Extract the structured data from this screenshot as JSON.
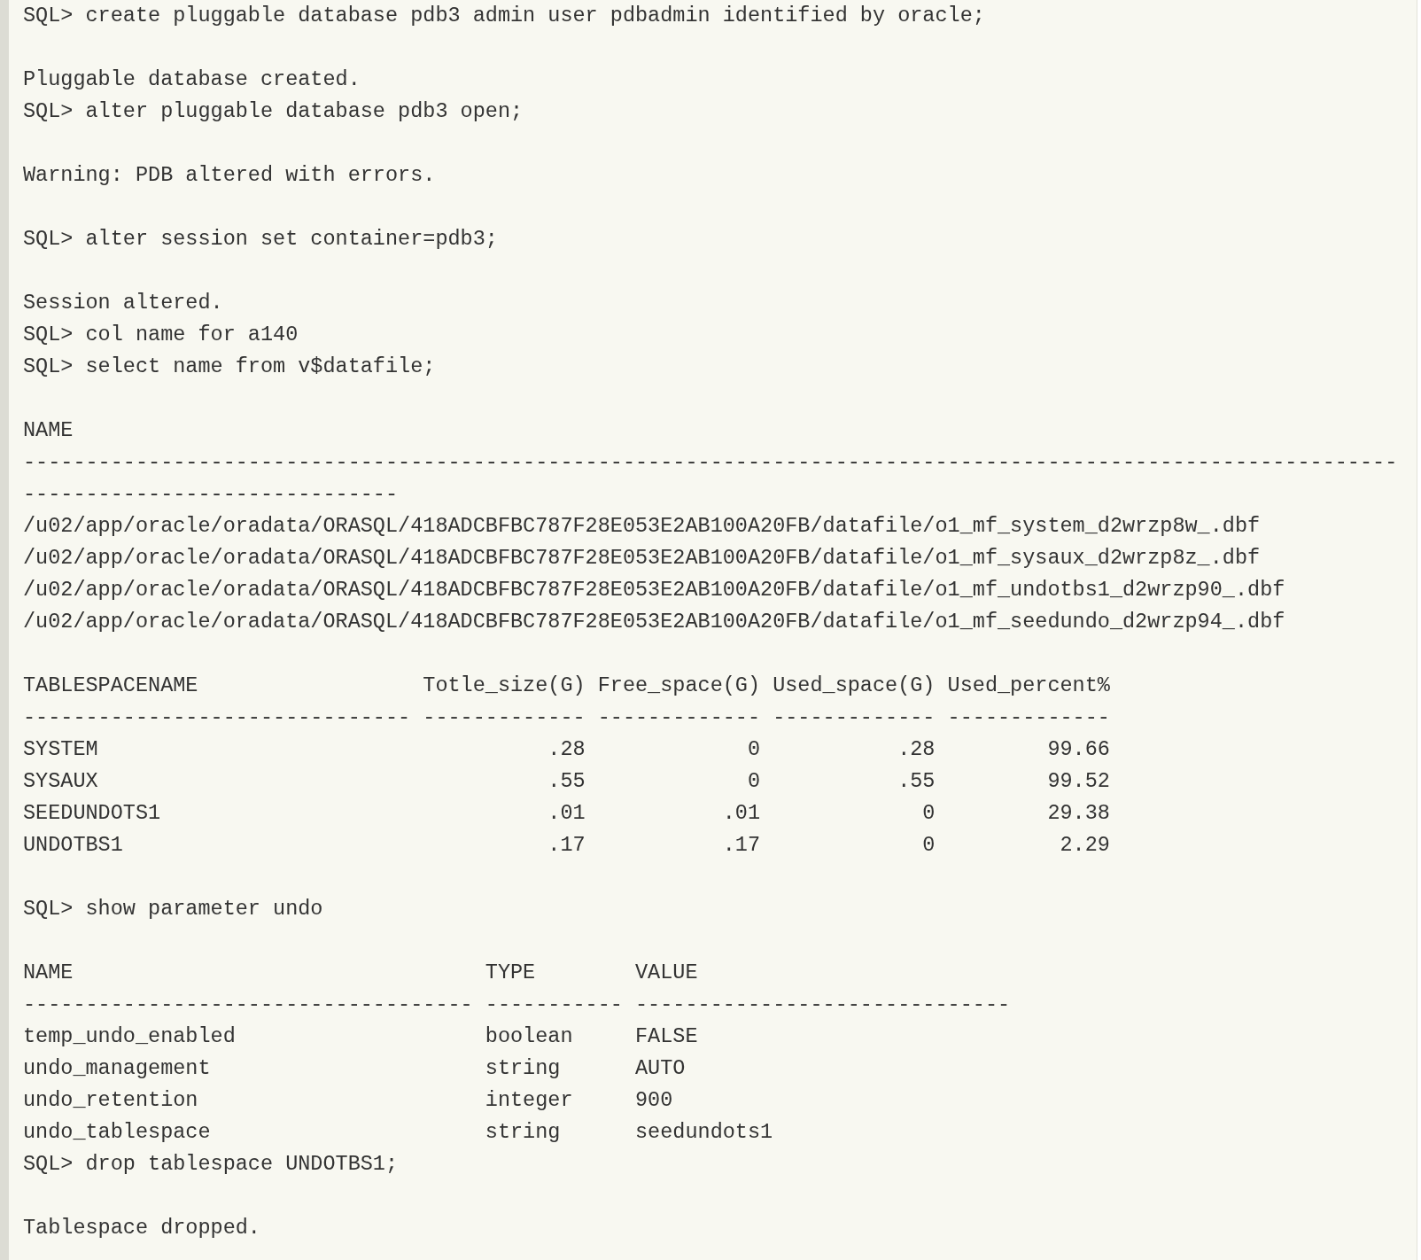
{
  "transcript": [
    [
      "SQL> create pluggable database pdb3 admin user pdbadmin identified by oracle;"
    ],
    [
      "Pluggable database created.",
      "SQL> alter pluggable database pdb3 open;"
    ],
    [
      "Warning: PDB altered with errors."
    ],
    [
      "SQL> alter session set container=pdb3;"
    ],
    [
      "Session altered.",
      "SQL> col name for a140",
      "SQL> select name from v$datafile;"
    ],
    [
      "NAME",
      "--------------------------------------------------------------------------------------------------------------------------------------------",
      "/u02/app/oracle/oradata/ORASQL/418ADCBFBC787F28E053E2AB100A20FB/datafile/o1_mf_system_d2wrzp8w_.dbf",
      "/u02/app/oracle/oradata/ORASQL/418ADCBFBC787F28E053E2AB100A20FB/datafile/o1_mf_sysaux_d2wrzp8z_.dbf",
      "/u02/app/oracle/oradata/ORASQL/418ADCBFBC787F28E053E2AB100A20FB/datafile/o1_mf_undotbs1_d2wrzp90_.dbf",
      "/u02/app/oracle/oradata/ORASQL/418ADCBFBC787F28E053E2AB100A20FB/datafile/o1_mf_seedundo_d2wrzp94_.dbf"
    ],
    [
      "TABLESPACENAME                  Totle_size(G) Free_space(G) Used_space(G) Used_percent%",
      "------------------------------- ------------- ------------- ------------- -------------",
      "SYSTEM                                    .28             0           .28         99.66",
      "SYSAUX                                    .55             0           .55         99.52",
      "SEEDUNDOTS1                               .01           .01             0         29.38",
      "UNDOTBS1                                  .17           .17             0          2.29"
    ],
    [
      "SQL> show parameter undo"
    ],
    [
      "NAME                                 TYPE        VALUE",
      "------------------------------------ ----------- ------------------------------",
      "temp_undo_enabled                    boolean     FALSE",
      "undo_management                      string      AUTO",
      "undo_retention                       integer     900",
      "undo_tablespace                      string      seedundots1",
      "SQL> drop tablespace UNDOTBS1;"
    ],
    [
      "Tablespace dropped."
    ]
  ]
}
